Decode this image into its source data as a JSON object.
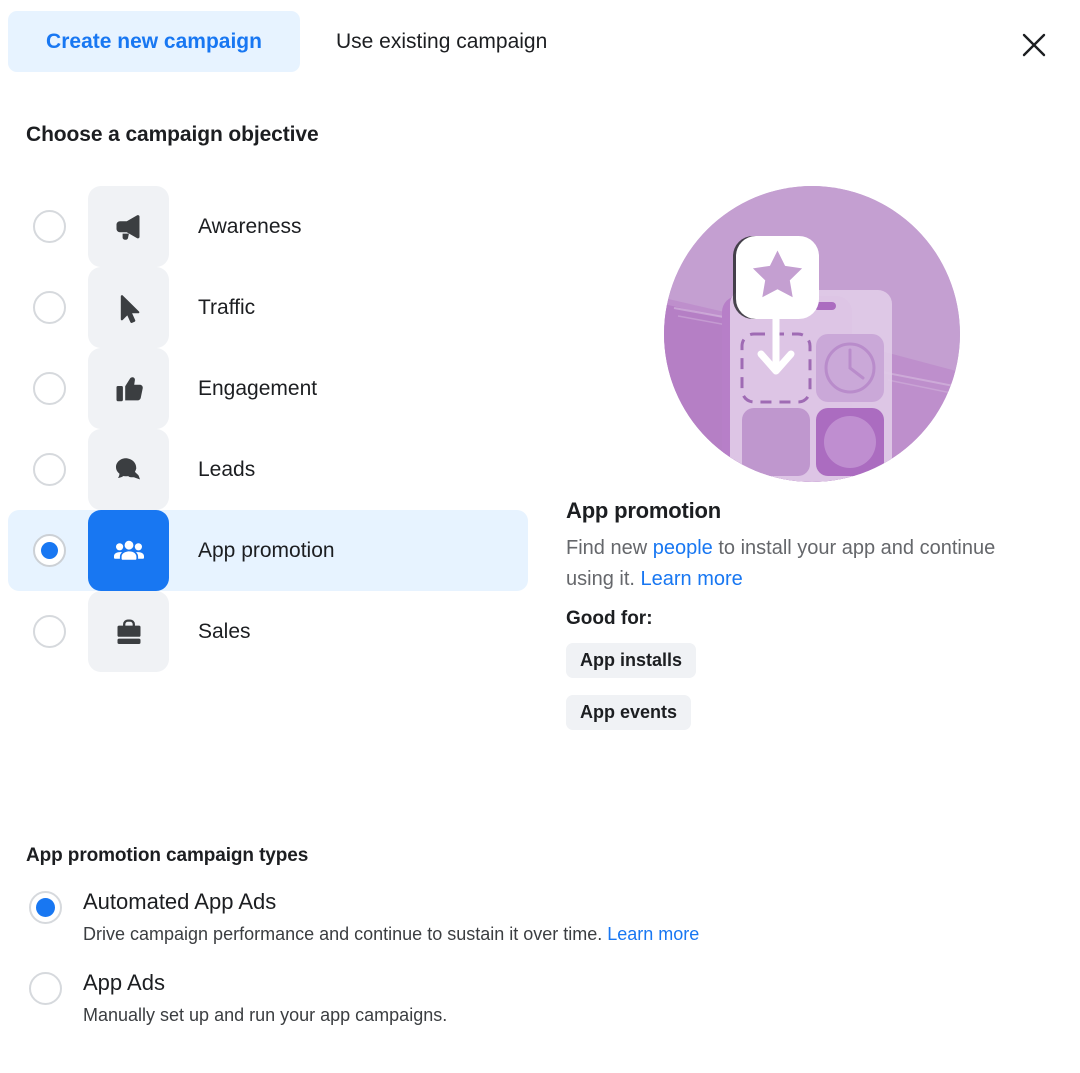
{
  "tabs": {
    "create_label": "Create new campaign",
    "existing_label": "Use existing campaign",
    "close_icon": "close-icon",
    "active_color": "#1877f2",
    "active_bg": "#e7f3ff"
  },
  "objective_section": {
    "title": "Choose a campaign objective",
    "selected": "App promotion",
    "items": [
      {
        "label": "Awareness",
        "icon": "megaphone-icon",
        "selected": false
      },
      {
        "label": "Traffic",
        "icon": "cursor-icon",
        "selected": false
      },
      {
        "label": "Engagement",
        "icon": "thumbs-up-icon",
        "selected": false
      },
      {
        "label": "Leads",
        "icon": "chat-bubbles-icon",
        "selected": false
      },
      {
        "label": "App promotion",
        "icon": "people-icon",
        "selected": true
      },
      {
        "label": "Sales",
        "icon": "briefcase-icon",
        "selected": false
      }
    ]
  },
  "detail": {
    "illustration": "app-promotion-illustration",
    "title": "App promotion",
    "desc_part1": "Find new ",
    "desc_link1": "people",
    "desc_part2": " to install your app and continue using it. ",
    "desc_link2": "Learn more",
    "good_for_label": "Good for:",
    "chips": [
      "App installs",
      "App events"
    ]
  },
  "campaign_types": {
    "title": "App promotion campaign types",
    "items": [
      {
        "label": "Automated App Ads",
        "desc": "Drive campaign performance and continue to sustain it over time. ",
        "link": "Learn more",
        "selected": true
      },
      {
        "label": "App Ads",
        "desc": "Manually set up and run your app campaigns.",
        "link": "",
        "selected": false
      }
    ]
  },
  "colors": {
    "accent": "#1877f2",
    "accent_bg": "#e7f3ff",
    "tile_bg": "#f0f2f5",
    "text": "#1c1e21",
    "muted": "#65676b",
    "illustration_purple": "#c09ccd"
  }
}
